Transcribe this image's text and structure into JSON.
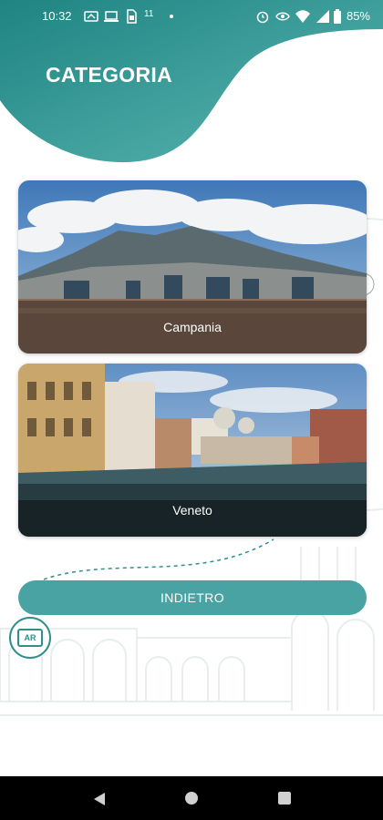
{
  "status_bar": {
    "time": "10:32",
    "battery": "85%",
    "icons": [
      "cast-icon",
      "laptop-icon",
      "sim-icon",
      "network-11-icon",
      "dot-icon",
      "alarm-icon",
      "eye-icon",
      "wifi-icon",
      "signal-icon",
      "battery-icon"
    ],
    "network_label": "11"
  },
  "header": {
    "title": "CATEGORIA"
  },
  "regions": [
    {
      "label": "Campania",
      "image": "naples-vesuvius-skyline"
    },
    {
      "label": "Veneto",
      "image": "venice-grand-canal"
    }
  ],
  "actions": {
    "back_label": "INDIETRO",
    "ar_label": "AR"
  },
  "colors": {
    "brand_teal": "#2e8f8d",
    "button_teal": "#4aa3a3",
    "header_gradient_start": "#1f8482",
    "header_gradient_end": "#5bb7b2"
  },
  "nav": {
    "icons": [
      "back-triangle-icon",
      "home-circle-icon",
      "recents-square-icon"
    ]
  }
}
